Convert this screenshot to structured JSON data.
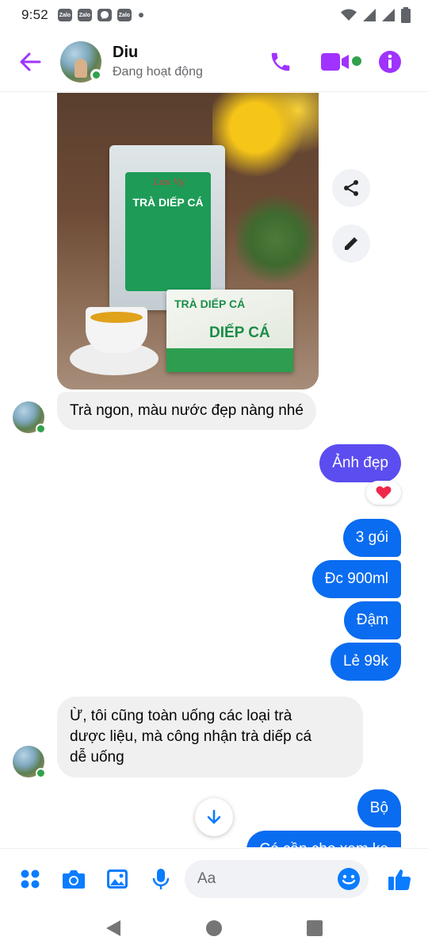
{
  "status_bar": {
    "time": "9:52",
    "notification_apps": [
      "Zalo",
      "Zalo",
      "messenger",
      "Zalo"
    ]
  },
  "header": {
    "contact_name": "Diu",
    "contact_status": "Đang hoạt động",
    "accent_color": "#a033ff",
    "online_color": "#31a24c"
  },
  "photo": {
    "bag_brand": "Lưu Vy",
    "bag_title": "TRÀ DIẾP CÁ",
    "box_title": "TRÀ DIẾP CÁ",
    "box_title_large": "DIẾP CÁ"
  },
  "messages": [
    {
      "id": "m1",
      "direction": "in",
      "text": "Trà ngon, màu nước đẹp nàng nhé"
    },
    {
      "id": "m2",
      "direction": "out",
      "text": "Ảnh đẹp",
      "reaction": "heart"
    },
    {
      "id": "m3",
      "direction": "out",
      "text": "3 gói"
    },
    {
      "id": "m4",
      "direction": "out",
      "text": "Đc 900ml"
    },
    {
      "id": "m5",
      "direction": "out",
      "text": "Đậm"
    },
    {
      "id": "m6",
      "direction": "out",
      "text": "Lẻ 99k"
    },
    {
      "id": "m7",
      "direction": "in",
      "lines": [
        "Ừ, tôi cũng toàn uống các loại trà",
        "dược liệu, mà công nhận trà diếp cá",
        "dễ uống"
      ]
    },
    {
      "id": "m8",
      "direction": "out",
      "text": "Bộ"
    },
    {
      "id": "m9",
      "direction": "out",
      "text": "Có cần cho xem ko"
    }
  ],
  "colors": {
    "outgoing_bubble": "#0a6cf0",
    "outgoing_bubble_accent": "#5b4df0",
    "incoming_bubble": "#f0f0f0",
    "composer_icon": "#0a7cff"
  },
  "composer": {
    "placeholder": "Aa"
  },
  "icons": {
    "back": "arrow-left-icon",
    "call": "phone-icon",
    "video": "video-camera-icon",
    "info": "info-icon",
    "share": "share-icon",
    "edit": "pencil-icon",
    "scroll_down": "arrow-down-icon",
    "menu": "four-dots-icon",
    "camera": "camera-icon",
    "gallery": "image-icon",
    "mic": "microphone-icon",
    "emoji": "smiley-icon",
    "like": "thumbs-up-icon"
  }
}
